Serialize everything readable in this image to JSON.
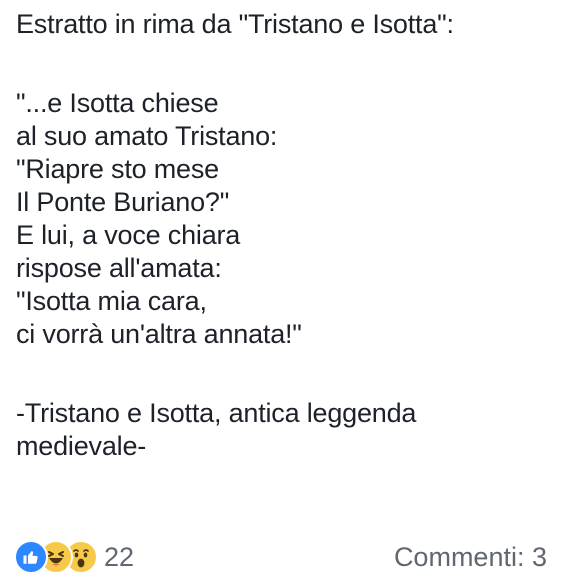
{
  "post": {
    "title": "Estratto in rima da \"Tristano e Isotta\":",
    "verses": [
      "\"...e Isotta chiese",
      "al suo amato Tristano:",
      "\"Riapre sto mese",
      "Il Ponte Buriano?\"",
      "E lui, a voce chiara",
      "rispose all'amata:",
      "\"Isotta mia cara,",
      "ci vorrà un'altra annata!\""
    ],
    "signature": [
      "-Tristano e Isotta, antica leggenda",
      "medievale-"
    ]
  },
  "footer": {
    "reaction_icons": [
      "like-icon",
      "haha-icon",
      "wow-icon"
    ],
    "reaction_count": "22",
    "comments_label": "Commenti: 3"
  },
  "colors": {
    "text": "#1d2129",
    "muted": "#606770",
    "like_blue": "#2d88ff",
    "emoji_yellow": "#f7c948"
  }
}
